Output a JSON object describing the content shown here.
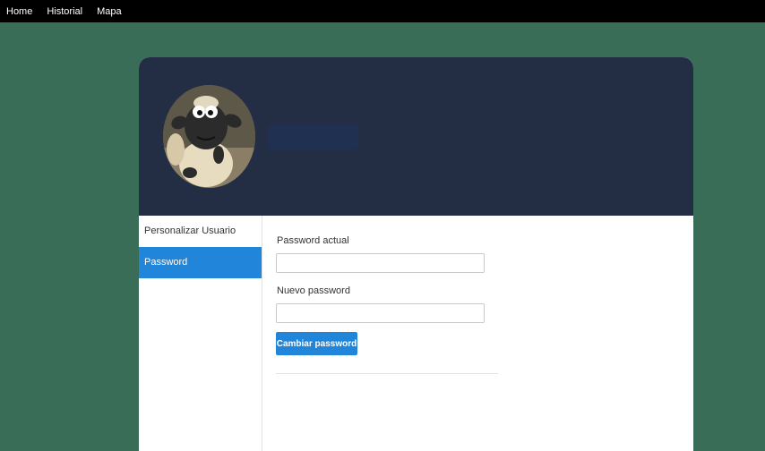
{
  "nav": {
    "items": [
      "Home",
      "Historial",
      "Mapa"
    ]
  },
  "profile": {
    "avatar_icon": "sheep-avatar-icon",
    "username": ""
  },
  "sidebar": {
    "items": [
      {
        "label": "Personalizar Usuario",
        "active": false
      },
      {
        "label": "Password",
        "active": true
      }
    ]
  },
  "form": {
    "current_password_label": "Password actual",
    "current_password_value": "",
    "new_password_label": "Nuevo password",
    "new_password_value": "",
    "submit_label": "Cambiar password"
  },
  "colors": {
    "background": "#3a6d58",
    "topnav": "#000000",
    "header": "#232e45",
    "accent": "#2186d9"
  }
}
